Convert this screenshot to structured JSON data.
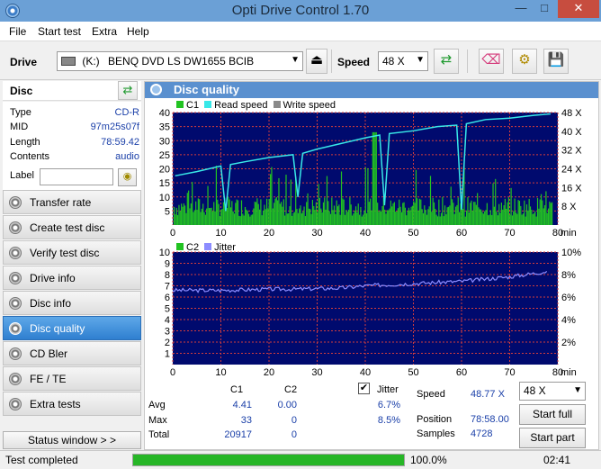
{
  "window": {
    "title": "Opti Drive Control 1.70"
  },
  "menu": [
    "File",
    "Start test",
    "Extra",
    "Help"
  ],
  "toolbar": {
    "drive_label": "Drive",
    "drive_letter": "(K:)",
    "drive_name": "BENQ DVD LS DW1655 BCIB",
    "speed_label": "Speed",
    "speed_value": "48 X"
  },
  "disc": {
    "header": "Disc",
    "rows": [
      {
        "key": "Type",
        "value": "CD-R"
      },
      {
        "key": "MID",
        "value": "97m25s07f"
      },
      {
        "key": "Length",
        "value": "78:59.42"
      },
      {
        "key": "Contents",
        "value": "audio"
      }
    ],
    "label_key": "Label",
    "label_value": ""
  },
  "nav": [
    {
      "label": "Transfer rate",
      "active": false
    },
    {
      "label": "Create test disc",
      "active": false
    },
    {
      "label": "Verify test disc",
      "active": false
    },
    {
      "label": "Drive info",
      "active": false
    },
    {
      "label": "Disc info",
      "active": false
    },
    {
      "label": "Disc quality",
      "active": true
    },
    {
      "label": "CD Bler",
      "active": false
    },
    {
      "label": "FE / TE",
      "active": false
    },
    {
      "label": "Extra tests",
      "active": false
    }
  ],
  "status_window_label": "Status window > >",
  "panel": {
    "title": "Disc quality"
  },
  "chart_data": [
    {
      "type": "bar",
      "legend": [
        "C1",
        "Read speed",
        "Write speed"
      ],
      "x_ticks": [
        0,
        10,
        20,
        30,
        40,
        50,
        60,
        70,
        80
      ],
      "x_unit": "min",
      "y_ticks_left": [
        5,
        10,
        15,
        20,
        25,
        30,
        35,
        40
      ],
      "y_ticks_right": [
        "8 X",
        "16 X",
        "24 X",
        "32 X",
        "40 X",
        "48 X"
      ],
      "xlim": [
        0,
        80
      ],
      "ylim": [
        0,
        40
      ],
      "grid": true,
      "colors": {
        "c1": "#22c322",
        "read_speed": "#38e8e8",
        "background": "#000a6e",
        "grid": "#d23c3c"
      },
      "c1_max": 33,
      "read_speed": {
        "x": [
          0.5,
          5,
          10,
          11,
          12,
          15,
          20,
          25,
          26,
          27,
          30,
          35,
          40,
          43,
          44,
          45,
          50,
          55,
          59,
          60,
          61,
          65,
          70,
          75,
          78.5
        ],
        "y": [
          17.5,
          19,
          21,
          5,
          21.5,
          22.5,
          24,
          25,
          10,
          25.5,
          27,
          29,
          31,
          32,
          7,
          32.5,
          33.5,
          35,
          35.5,
          5.5,
          36,
          37.5,
          38,
          39,
          39.5
        ]
      }
    },
    {
      "type": "line",
      "legend": [
        "C2",
        "Jitter"
      ],
      "x_ticks": [
        0,
        10,
        20,
        30,
        40,
        50,
        60,
        70,
        80
      ],
      "x_unit": "min",
      "y_ticks_left": [
        1,
        2,
        3,
        4,
        5,
        6,
        7,
        8,
        9,
        10
      ],
      "y_ticks_right": [
        "2%",
        "4%",
        "6%",
        "8%",
        "10%"
      ],
      "xlim": [
        0,
        80
      ],
      "ylim": [
        0,
        10
      ],
      "grid": true,
      "colors": {
        "jitter": "#8c8cff",
        "c2": "#22c322",
        "background": "#000a6e",
        "grid": "#d23c3c"
      },
      "jitter": {
        "x": [
          0,
          10,
          15,
          20,
          25,
          30,
          35,
          40,
          45,
          50,
          55,
          60,
          65,
          70,
          75,
          78
        ],
        "y": [
          6.6,
          6.6,
          6.65,
          6.7,
          6.7,
          6.75,
          6.8,
          7.0,
          7.1,
          7.2,
          7.3,
          7.4,
          7.6,
          7.8,
          8.1,
          8.3
        ]
      }
    }
  ],
  "stats": {
    "col_c1": "C1",
    "col_c2": "C2",
    "jitter_label": "Jitter",
    "jitter_checked": true,
    "rows": [
      {
        "name": "Avg",
        "c1": "4.41",
        "c2": "0.00",
        "jitter": "6.7%"
      },
      {
        "name": "Max",
        "c1": "33",
        "c2": "0",
        "jitter": "8.5%"
      },
      {
        "name": "Total",
        "c1": "20917",
        "c2": "0",
        "jitter": ""
      }
    ],
    "speed_label": "Speed",
    "speed_value": "48.77 X",
    "position_label": "Position",
    "position_value": "78:58.00",
    "samples_label": "Samples",
    "samples_value": "4728",
    "speed_select": "48 X",
    "start_full": "Start full",
    "start_part": "Start part"
  },
  "statusbar": {
    "text": "Test completed",
    "progress": 100.0,
    "progress_text": "100.0%",
    "time": "02:41"
  }
}
